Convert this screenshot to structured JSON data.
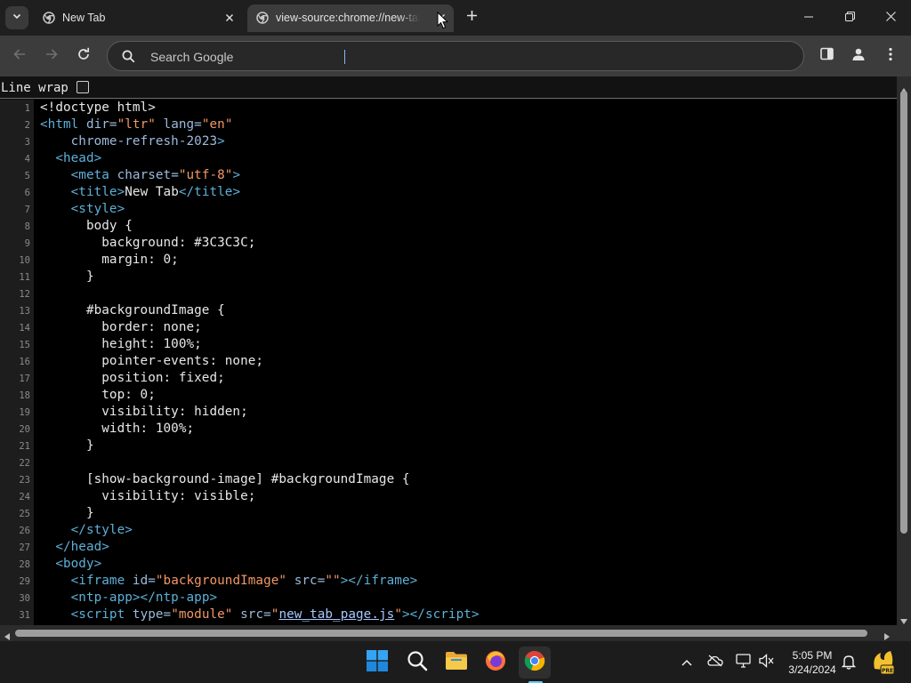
{
  "tabs": [
    {
      "title": "New Tab",
      "active": false
    },
    {
      "title": "view-source:chrome://new-tab-page",
      "active": true
    }
  ],
  "omnibox": {
    "placeholder": "Search Google",
    "value": ""
  },
  "viewsource": {
    "line_wrap_label": "Line wrap",
    "line_wrap_checked": false
  },
  "source_lines": [
    {
      "n": "1",
      "html": "&lt;!doctype html&gt;"
    },
    {
      "n": "2",
      "html": "<span class=\"tag\">&lt;html </span><span class=\"attr\">dir=</span><span class=\"val\">\"ltr\"</span><span class=\"attr\"> lang=</span><span class=\"val\">\"en\"</span>"
    },
    {
      "n": "3",
      "html": "    <span class=\"attr\">chrome-refresh-2023</span><span class=\"tag\">&gt;</span>"
    },
    {
      "n": "4",
      "html": "  <span class=\"tag\">&lt;head&gt;</span>"
    },
    {
      "n": "5",
      "html": "    <span class=\"tag\">&lt;meta </span><span class=\"attr\">charset=</span><span class=\"val\">\"utf-8\"</span><span class=\"tag\">&gt;</span>"
    },
    {
      "n": "6",
      "html": "    <span class=\"tag\">&lt;title&gt;</span>New Tab<span class=\"tag\">&lt;/title&gt;</span>"
    },
    {
      "n": "7",
      "html": "    <span class=\"tag\">&lt;style&gt;</span>"
    },
    {
      "n": "8",
      "html": "      body {"
    },
    {
      "n": "9",
      "html": "        background: #3C3C3C;"
    },
    {
      "n": "10",
      "html": "        margin: 0;"
    },
    {
      "n": "11",
      "html": "      }"
    },
    {
      "n": "12",
      "html": ""
    },
    {
      "n": "13",
      "html": "      #backgroundImage {"
    },
    {
      "n": "14",
      "html": "        border: none;"
    },
    {
      "n": "15",
      "html": "        height: 100%;"
    },
    {
      "n": "16",
      "html": "        pointer-events: none;"
    },
    {
      "n": "17",
      "html": "        position: fixed;"
    },
    {
      "n": "18",
      "html": "        top: 0;"
    },
    {
      "n": "19",
      "html": "        visibility: hidden;"
    },
    {
      "n": "20",
      "html": "        width: 100%;"
    },
    {
      "n": "21",
      "html": "      }"
    },
    {
      "n": "22",
      "html": ""
    },
    {
      "n": "23",
      "html": "      [show-background-image] #backgroundImage {"
    },
    {
      "n": "24",
      "html": "        visibility: visible;"
    },
    {
      "n": "25",
      "html": "      }"
    },
    {
      "n": "26",
      "html": "    <span class=\"tag\">&lt;/style&gt;</span>"
    },
    {
      "n": "27",
      "html": "  <span class=\"tag\">&lt;/head&gt;</span>"
    },
    {
      "n": "28",
      "html": "  <span class=\"tag\">&lt;body&gt;</span>"
    },
    {
      "n": "29",
      "html": "    <span class=\"tag\">&lt;iframe </span><span class=\"attr\">id=</span><span class=\"val\">\"backgroundImage\"</span><span class=\"attr\"> src=</span><span class=\"val\">\"\"</span><span class=\"tag\">&gt;&lt;/iframe&gt;</span>"
    },
    {
      "n": "30",
      "html": "    <span class=\"tag\">&lt;ntp-app&gt;&lt;/ntp-app&gt;</span>"
    },
    {
      "n": "31",
      "html": "    <span class=\"tag\">&lt;script </span><span class=\"attr\">type=</span><span class=\"val\">\"module\"</span><span class=\"attr\"> src=</span><span class=\"val\">\"</span><span class=\"link\">new_tab_page.js</span><span class=\"val\">\"</span><span class=\"tag\">&gt;&lt;/script&gt;</span>"
    }
  ],
  "taskbar": {
    "apps": [
      "start-icon",
      "search-icon",
      "file-explorer-icon",
      "firefox-icon",
      "chrome-icon"
    ],
    "time": "5:05 PM",
    "date": "3/24/2024"
  },
  "colors": {
    "tag": "#5db0d7",
    "attribute": "#9bbbdc",
    "value": "#f29766",
    "link": "#a6c8ff",
    "chrome_active_tab": "#3c3c3c",
    "taskbar_indicator": "#60cdff"
  }
}
